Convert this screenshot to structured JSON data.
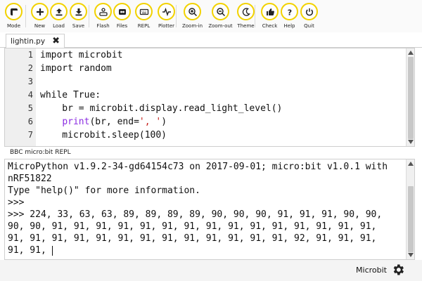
{
  "toolbar": {
    "buttons": [
      {
        "label": "Mode",
        "icon": "mode-icon"
      },
      {
        "label": "New",
        "icon": "plus-icon"
      },
      {
        "label": "Load",
        "icon": "upload-icon"
      },
      {
        "label": "Save",
        "icon": "download-icon"
      },
      {
        "label": "Flash",
        "icon": "flash-icon"
      },
      {
        "label": "Files",
        "icon": "files-icon"
      },
      {
        "label": "REPL",
        "icon": "keyboard-icon"
      },
      {
        "label": "Plotter",
        "icon": "plotter-icon"
      },
      {
        "label": "Zoom-in",
        "icon": "zoom-in-icon"
      },
      {
        "label": "Zoom-out",
        "icon": "zoom-out-icon"
      },
      {
        "label": "Theme",
        "icon": "moon-icon"
      },
      {
        "label": "Check",
        "icon": "thumbs-up-icon"
      },
      {
        "label": "Help",
        "icon": "question-icon"
      },
      {
        "label": "Quit",
        "icon": "power-icon"
      }
    ],
    "accent_color": "#f2d200"
  },
  "tab": {
    "label": "lightin.py",
    "close": "✖"
  },
  "editor": {
    "lines": [
      {
        "n": "1",
        "text": "import microbit"
      },
      {
        "n": "2",
        "text": "import random"
      },
      {
        "n": "3",
        "text": ""
      },
      {
        "n": "4",
        "text": "while True:"
      },
      {
        "n": "5",
        "text": "    br = microbit.display.read_light_level()"
      },
      {
        "n": "6",
        "pre": "    ",
        "fn": "print",
        "mid": "(br, end=",
        "str": "', '",
        "post": ")"
      },
      {
        "n": "7",
        "text": "    microbit.sleep(100)"
      }
    ]
  },
  "repl": {
    "title": "BBC micro:bit REPL",
    "lines": [
      "MicroPython v1.9.2-34-gd64154c73 on 2017-09-01; micro:bit v1.0.1 with",
      "nRF51822",
      "Type \"help()\" for more information.",
      ">>>",
      ">>> 224, 33, 63, 63, 89, 89, 89, 89, 90, 90, 90, 91, 91, 91, 90, 90,",
      "90, 90, 91, 91, 91, 91, 91, 91, 91, 91, 91, 91, 91, 91, 91, 91, 91,",
      "91, 91, 91, 91, 91, 91, 91, 91, 91, 91, 91, 91, 91, 92, 91, 91, 91,",
      "91, 91, "
    ]
  },
  "status": {
    "mode": "Microbit",
    "icon": "gear-icon"
  }
}
